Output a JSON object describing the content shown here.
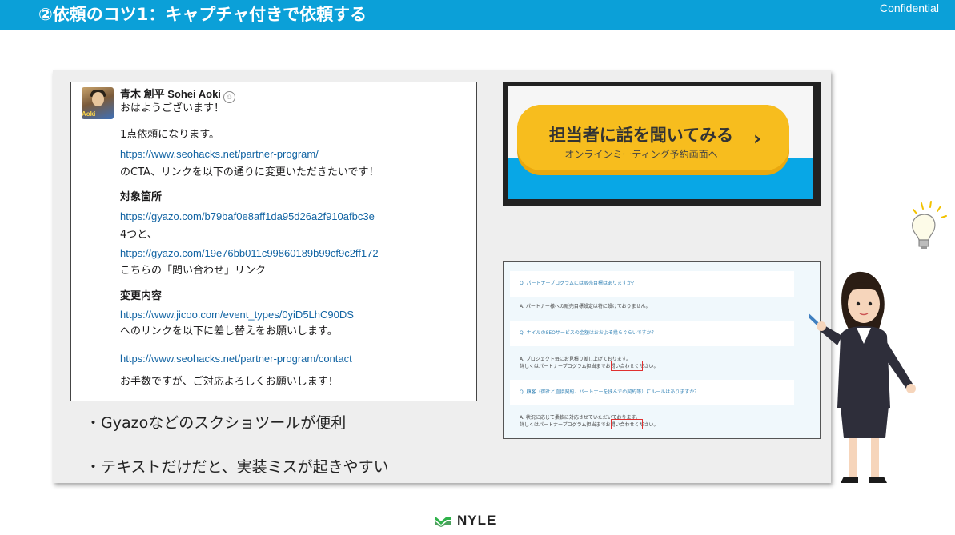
{
  "header": {
    "title": "②依頼のコツ1：キャプチャ付きで依頼する",
    "confidential": "Confidential"
  },
  "chat": {
    "author": "青木 創平 Sohei Aoki",
    "avatar_badge": "Aoki",
    "lines": [
      {
        "text": "おはようございます！",
        "style": "normal"
      },
      {
        "text": "1点依頼になります。",
        "style": "normal"
      },
      {
        "text": "https://www.seohacks.net/partner-program/",
        "style": "link"
      },
      {
        "text": "のCTA、リンクを以下の通りに変更いただきたいです！",
        "style": "normal"
      },
      {
        "text": "対象箇所",
        "style": "bold"
      },
      {
        "text": "https://gyazo.com/b79baf0e8aff1da95d26a2f910afbc3e",
        "style": "link"
      },
      {
        "text": "4つと、",
        "style": "normal"
      },
      {
        "text": "https://gyazo.com/19e76bb011c99860189b99cf9c2ff172",
        "style": "link"
      },
      {
        "text": "こちらの「問い合わせ」リンク",
        "style": "normal"
      },
      {
        "text": "変更内容",
        "style": "bold"
      },
      {
        "text": "https://www.jicoo.com/event_types/0yiD5LhC90DS",
        "style": "link"
      },
      {
        "text": "へのリンクを以下に差し替えをお願いします。",
        "style": "normal"
      },
      {
        "text": "https://www.seohacks.net/partner-program/contact",
        "style": "link"
      },
      {
        "text": "お手数ですが、ご対応よろしくお願いします！",
        "style": "normal"
      }
    ]
  },
  "cta_screenshot": {
    "main": "担当者に話を聞いてみる",
    "sub": "オンラインミーティング予約画面へ",
    "arrow": "›"
  },
  "faq_screenshot": {
    "items": [
      {
        "q": "Q. パートナープログラムには販売目標はありますか？",
        "a": [
          "A. パートナー様への販売目標設定は特に設けておりません。"
        ]
      },
      {
        "q": "Q. ナイルのSEOサービスの金額はおおよそ幾らぐらいですか？",
        "a": [
          "A. プロジェクト毎にお見積り差し上げております。",
          "詳しくはパートナープログラム担当までお問い合わせください。"
        ]
      },
      {
        "q": "Q. 顧客（御社と直接契約、パートナーを挟んでの契約等）にルールはありますか？",
        "a": [
          "A. 状況に応じて柔軟に対応させていただいております。",
          "詳しくはパートナープログラム担当までお問い合わせください。"
        ]
      }
    ]
  },
  "bullets": [
    "・Gyazoなどのスクショツールが便利",
    "・テキストだけだと、実装ミスが起きやすい"
  ],
  "footer": {
    "logo_text": "NYLE"
  },
  "colors": {
    "header_bg": "#0ba0d8",
    "link": "#1264a3",
    "cta_button": "#f7bd1e",
    "highlight_box": "#e03030"
  }
}
